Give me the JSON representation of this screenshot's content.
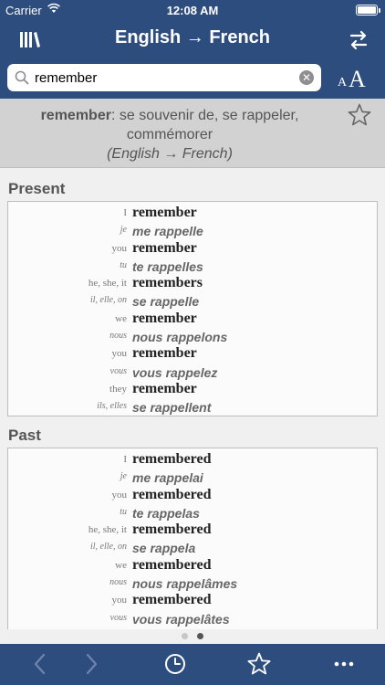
{
  "status": {
    "carrier": "Carrier",
    "time": "12:08 AM"
  },
  "nav": {
    "title": "English → French"
  },
  "search": {
    "value": "remember"
  },
  "fontsize": {
    "small": "A",
    "big": "A"
  },
  "definition": {
    "headword": "remember",
    "translation": ": se souvenir de, se rappeler, commémorer",
    "direction": "(English → French)"
  },
  "present": {
    "title": "Present",
    "rows": [
      {
        "pron": "I",
        "verb": "remember",
        "lang": "en"
      },
      {
        "pron": "je",
        "verb": "me rappelle",
        "lang": "fr"
      },
      {
        "pron": "you",
        "verb": "remember",
        "lang": "en"
      },
      {
        "pron": "tu",
        "verb": "te rappelles",
        "lang": "fr"
      },
      {
        "pron": "he, she, it",
        "verb": "remembers",
        "lang": "en"
      },
      {
        "pron": "il, elle, on",
        "verb": "se rappelle",
        "lang": "fr"
      },
      {
        "pron": "we",
        "verb": "remember",
        "lang": "en"
      },
      {
        "pron": "nous",
        "verb": "nous rappelons",
        "lang": "fr"
      },
      {
        "pron": "you",
        "verb": "remember",
        "lang": "en"
      },
      {
        "pron": "vous",
        "verb": "vous rappelez",
        "lang": "fr"
      },
      {
        "pron": "they",
        "verb": "remember",
        "lang": "en"
      },
      {
        "pron": "ils, elles",
        "verb": "se rappellent",
        "lang": "fr"
      }
    ]
  },
  "past": {
    "title": "Past",
    "rows": [
      {
        "pron": "I",
        "verb": "remembered",
        "lang": "en"
      },
      {
        "pron": "je",
        "verb": "me rappelai",
        "lang": "fr"
      },
      {
        "pron": "you",
        "verb": "remembered",
        "lang": "en"
      },
      {
        "pron": "tu",
        "verb": "te rappelas",
        "lang": "fr"
      },
      {
        "pron": "he, she, it",
        "verb": "remembered",
        "lang": "en"
      },
      {
        "pron": "il, elle, on",
        "verb": "se rappela",
        "lang": "fr"
      },
      {
        "pron": "we",
        "verb": "remembered",
        "lang": "en"
      },
      {
        "pron": "nous",
        "verb": "nous rappelâmes",
        "lang": "fr"
      },
      {
        "pron": "you",
        "verb": "remembered",
        "lang": "en"
      },
      {
        "pron": "vous",
        "verb": "vous rappelâtes",
        "lang": "fr"
      }
    ]
  },
  "colors": {
    "brand": "#2e4d7f",
    "panel": "#d2d2d2",
    "background": "#f0f0f0"
  },
  "toolbar": {
    "icons": [
      "back-icon",
      "forward-icon",
      "history-icon",
      "star-icon",
      "more-icon"
    ]
  }
}
